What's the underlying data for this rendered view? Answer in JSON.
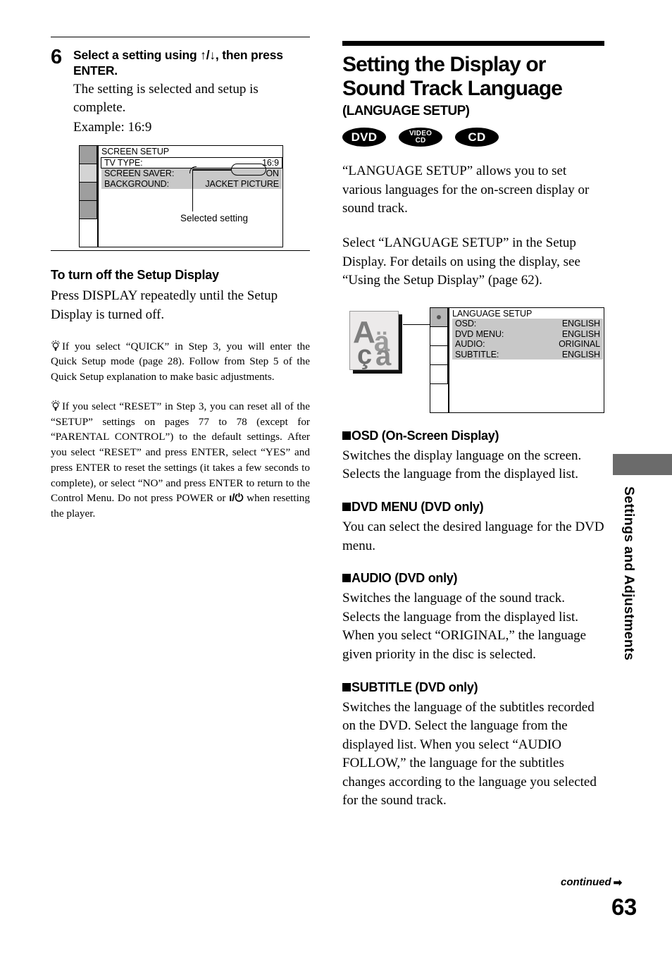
{
  "page": {
    "number": "63",
    "continued_label": "continued",
    "continued_arrow": "➡",
    "side_tab_label": "Settings and Adjustments"
  },
  "left_column": {
    "step": {
      "number": "6",
      "heading": "Select a setting using ↑/↓, then press ENTER.",
      "body": "The setting is selected and setup is complete.",
      "example": "Example: 16:9"
    },
    "screen_setup_osd": {
      "title": "SCREEN SETUP",
      "rows": [
        {
          "label": "TV TYPE:",
          "value": "16:9",
          "selected": true
        },
        {
          "label": "SCREEN SAVER:",
          "value": "ON",
          "selected": false
        },
        {
          "label": "BACKGROUND:",
          "value": "JACKET PICTURE",
          "selected": false
        }
      ],
      "callout": "Selected setting"
    },
    "turn_off": {
      "heading": "To turn off the Setup Display",
      "body": "Press DISPLAY repeatedly until the Setup Display is turned off."
    },
    "tips": [
      {
        "icon": "lightbulb-icon",
        "text": "If you select “QUICK” in Step 3, you will enter the Quick Setup mode (page 28). Follow from Step 5 of the Quick Setup explanation to make basic adjustments."
      },
      {
        "icon": "lightbulb-icon",
        "text_part1": "If you select “RESET” in Step 3, you can reset all of the “SETUP” settings on pages 77 to 78 (except for “PARENTAL CONTROL”) to the default settings. After you select “RESET” and press ENTER, select “YES” and press ENTER to reset the settings (it takes a few seconds to complete), or select “NO” and press ENTER to return to the Control Menu. Do not press POWER or ",
        "power_symbol": "ı/⏻",
        "text_part2": " when resetting the player."
      }
    ]
  },
  "right_column": {
    "title": "Setting the Display or Sound Track Language",
    "subtitle": "(LANGUAGE SETUP)",
    "badges": [
      {
        "name": "dvd-badge",
        "label": "DVD"
      },
      {
        "name": "video-cd-badge",
        "line1": "VIDEO",
        "line2": "CD"
      },
      {
        "name": "cd-badge",
        "label": "CD"
      }
    ],
    "intro1": "“LANGUAGE SETUP” allows you to set various languages for the on-screen display or sound track.",
    "intro2": "Select “LANGUAGE SETUP” in the Setup Display. For details on using the display, see “Using the Setup Display” (page 62).",
    "language_setup_osd": {
      "icon_name": "language-characters-icon",
      "icon_glyphs": [
        "A",
        "ä",
        "ç",
        "à"
      ],
      "title": "LANGUAGE SETUP",
      "rows": [
        {
          "label": "OSD:",
          "value": "ENGLISH"
        },
        {
          "label": "DVD MENU:",
          "value": "ENGLISH"
        },
        {
          "label": "AUDIO:",
          "value": "ORIGINAL"
        },
        {
          "label": "SUBTITLE:",
          "value": "ENGLISH"
        }
      ]
    },
    "sections": [
      {
        "heading": "OSD (On-Screen Display)",
        "body": "Switches the display language on the screen. Selects the language from the displayed list."
      },
      {
        "heading": "DVD MENU (DVD only)",
        "body": "You can select the desired language for the DVD menu."
      },
      {
        "heading": "AUDIO (DVD only)",
        "body": "Switches the language of the sound track. Selects the language from the displayed list. When you select “ORIGINAL,” the language given priority in the disc is selected."
      },
      {
        "heading": "SUBTITLE (DVD only)",
        "body": "Switches the language of the subtitles recorded on the DVD. Select the language from the displayed list. When you select “AUDIO FOLLOW,” the language for the subtitles changes according to the language you selected for the sound track."
      }
    ]
  }
}
